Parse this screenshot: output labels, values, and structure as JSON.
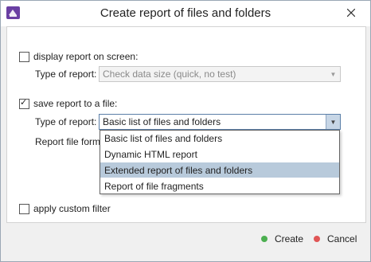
{
  "window": {
    "title": "Create report of files and folders"
  },
  "icons": {
    "app": "app-icon",
    "close": "close-icon"
  },
  "display_section": {
    "checkbox_label": "display report on screen:",
    "checked": false,
    "type_label": "Type of report:",
    "type_value": "Check data size (quick, no test)"
  },
  "save_section": {
    "checkbox_label": "save report to a file:",
    "checked": true,
    "type_label": "Type of report:",
    "type_value": "Basic list of files and folders",
    "format_label": "Report file format:"
  },
  "dropdown": {
    "options": [
      "Basic list of files and folders",
      "Dynamic HTML report",
      "Extended report of files and folders",
      "Report of file fragments"
    ],
    "highlighted_index": 2
  },
  "filter": {
    "checkbox_label": "apply custom filter",
    "checked": false
  },
  "footer": {
    "create_label": "Create",
    "create_color": "#4caf50",
    "cancel_label": "Cancel",
    "cancel_color": "#e05656"
  }
}
